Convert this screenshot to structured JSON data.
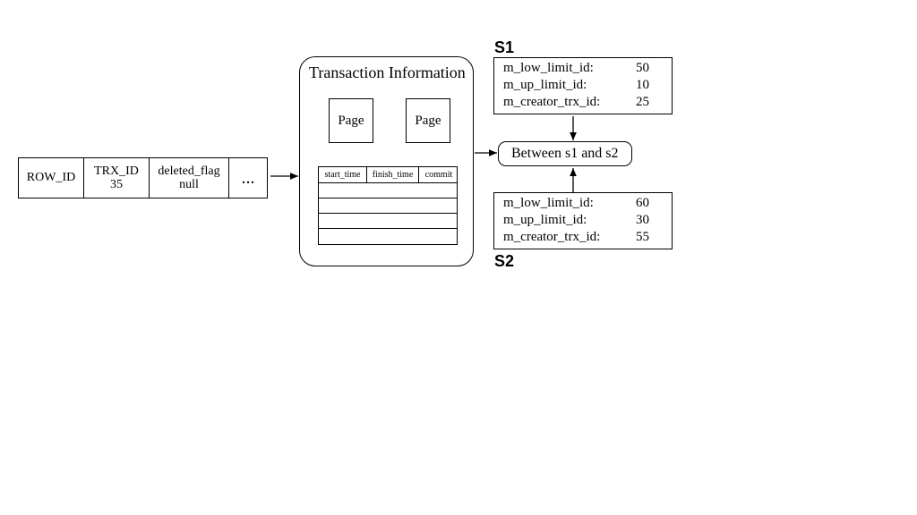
{
  "row": {
    "cells": [
      {
        "line1": "ROW_ID",
        "line2": ""
      },
      {
        "line1": "TRX_ID",
        "line2": "35"
      },
      {
        "line1": "deleted_flag",
        "line2": "null"
      },
      {
        "line1": "...",
        "line2": ""
      }
    ]
  },
  "trx": {
    "title": "Transaction Information",
    "page1": "Page",
    "page2": "Page",
    "log_headers": [
      "start_time",
      "finish_time",
      "commit"
    ]
  },
  "between_label": "Between s1 and s2",
  "s1": {
    "label": "S1",
    "fields": [
      {
        "k": "m_low_limit_id:",
        "v": "50"
      },
      {
        "k": "m_up_limit_id:",
        "v": "10"
      },
      {
        "k": "m_creator_trx_id:",
        "v": "25"
      }
    ]
  },
  "s2": {
    "label": "S2",
    "fields": [
      {
        "k": "m_low_limit_id:",
        "v": "60"
      },
      {
        "k": "m_up_limit_id:",
        "v": "30"
      },
      {
        "k": "m_creator_trx_id:",
        "v": "55"
      }
    ]
  }
}
